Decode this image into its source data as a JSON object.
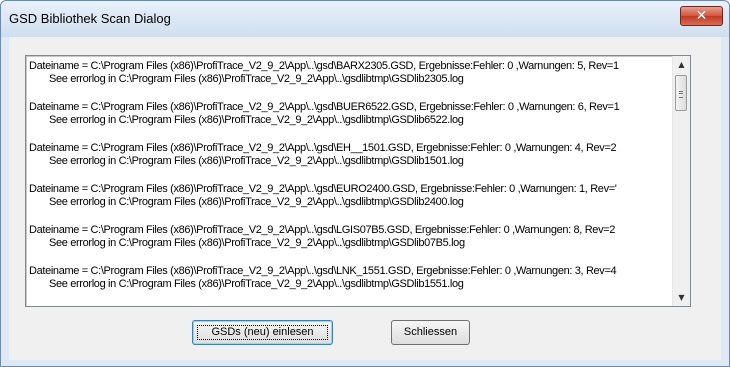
{
  "window": {
    "title": "GSD Bibliothek Scan Dialog",
    "close_glyph": "✕"
  },
  "log": {
    "entries": [
      {
        "line1": "Dateiname = C:\\Program Files (x86)\\ProfiTrace_V2_9_2\\App\\..\\gsd\\BARX2305.GSD, Ergebnisse:Fehler: 0 ,Warnungen: 5, Rev=1",
        "line2": "See errorlog in C:\\Program Files (x86)\\ProfiTrace_V2_9_2\\App\\..\\gsdlibtmp\\GSDlib2305.log"
      },
      {
        "line1": "Dateiname = C:\\Program Files (x86)\\ProfiTrace_V2_9_2\\App\\..\\gsd\\BUER6522.GSD, Ergebnisse:Fehler: 0 ,Warnungen: 6, Rev=1",
        "line2": "See errorlog in C:\\Program Files (x86)\\ProfiTrace_V2_9_2\\App\\..\\gsdlibtmp\\GSDlib6522.log"
      },
      {
        "line1": "Dateiname = C:\\Program Files (x86)\\ProfiTrace_V2_9_2\\App\\..\\gsd\\EH__1501.GSD, Ergebnisse:Fehler: 0 ,Warnungen: 4, Rev=2",
        "line2": "See errorlog in C:\\Program Files (x86)\\ProfiTrace_V2_9_2\\App\\..\\gsdlibtmp\\GSDlib1501.log"
      },
      {
        "line1": "Dateiname = C:\\Program Files (x86)\\ProfiTrace_V2_9_2\\App\\..\\gsd\\EURO2400.GSD, Ergebnisse:Fehler: 0 ,Warnungen: 1, Rev='",
        "line2": "See errorlog in C:\\Program Files (x86)\\ProfiTrace_V2_9_2\\App\\..\\gsdlibtmp\\GSDlib2400.log"
      },
      {
        "line1": "Dateiname = C:\\Program Files (x86)\\ProfiTrace_V2_9_2\\App\\..\\gsd\\LGIS07B5.GSD, Ergebnisse:Fehler: 0 ,Warnungen: 8, Rev=2",
        "line2": "See errorlog in C:\\Program Files (x86)\\ProfiTrace_V2_9_2\\App\\..\\gsdlibtmp\\GSDlib07B5.log"
      },
      {
        "line1": "Dateiname = C:\\Program Files (x86)\\ProfiTrace_V2_9_2\\App\\..\\gsd\\LNK_1551.GSD, Ergebnisse:Fehler: 0 ,Warnungen: 3, Rev=4",
        "line2": "See errorlog in C:\\Program Files (x86)\\ProfiTrace_V2_9_2\\App\\..\\gsdlibtmp\\GSDlib1551.log"
      }
    ]
  },
  "scrollbar": {
    "up_glyph": "▲",
    "down_glyph": "▼"
  },
  "buttons": {
    "load_label": "GSDs (neu) einlesen",
    "close_label": "Schliessen"
  },
  "colors": {
    "close_button": "#c13a22",
    "title_bar": "#cfdeef",
    "focus_border": "#3c7fb1"
  }
}
